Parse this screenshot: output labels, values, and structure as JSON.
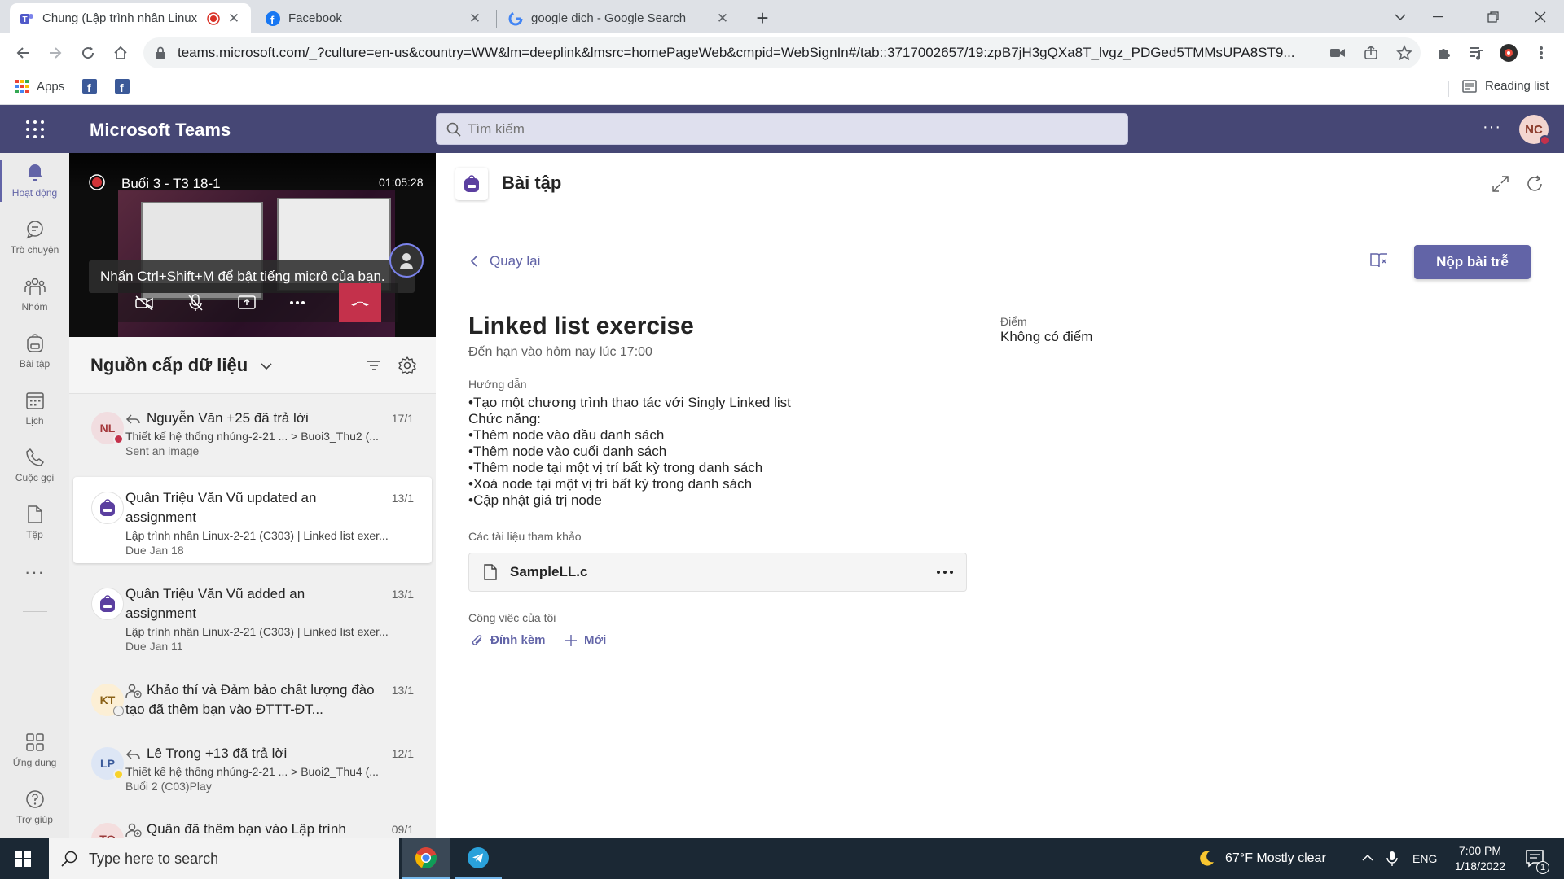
{
  "browser": {
    "tabs": [
      {
        "title": "Chung (Lập trình nhân Linux",
        "recording": true
      },
      {
        "title": "Facebook"
      },
      {
        "title": "google dich - Google Search"
      }
    ],
    "new_tab": "+",
    "url": "teams.microsoft.com/_?culture=en-us&country=WW&lm=deeplink&lmsrc=homePageWeb&cmpid=WebSignIn#/tab::3717002657/19:zpB7jH3gQXa8T_lvgz_PDGed5TMMsUPA8ST9...",
    "bookmarks": {
      "apps": "Apps",
      "reading_list": "Reading list"
    }
  },
  "teams": {
    "app_name": "Microsoft Teams",
    "search_placeholder": "Tìm kiếm",
    "avatar": "NC",
    "more": "···"
  },
  "rail": [
    {
      "label": "Hoạt động",
      "icon": "bell-icon",
      "active": true
    },
    {
      "label": "Trò chuyện",
      "icon": "chat-icon"
    },
    {
      "label": "Nhóm",
      "icon": "teams-icon"
    },
    {
      "label": "Bài tập",
      "icon": "backpack-icon"
    },
    {
      "label": "Lịch",
      "icon": "calendar-icon"
    },
    {
      "label": "Cuộc gọi",
      "icon": "phone-icon"
    },
    {
      "label": "Tệp",
      "icon": "file-icon"
    }
  ],
  "rail_more": "···",
  "rail_bottom": [
    {
      "label": "Ứng dụng",
      "icon": "apps-icon"
    },
    {
      "label": "Trợ giúp",
      "icon": "help-icon"
    }
  ],
  "meeting": {
    "title": "Buổi 3 - T3 18-1",
    "timer": "01:05:28",
    "toast": "Nhấn Ctrl+Shift+M để bật tiếng micrô của bạn."
  },
  "feed": {
    "title": "Nguồn cấp dữ liệu",
    "items": [
      {
        "avatar": "NL",
        "line1": "Nguyễn Văn +25 đã trả lời",
        "date": "17/1",
        "line2": "Thiết kế hệ thống nhúng-2-21 ...  > Buoi3_Thu2 (...",
        "line3": "Sent an image"
      },
      {
        "avatar": "",
        "line1": "Quân Triệu Văn Vũ updated an assignment",
        "date": "13/1",
        "line2": "Lập trình nhân Linux-2-21 (C303) | Linked list exer...",
        "line3": "Due Jan 18"
      },
      {
        "avatar": "",
        "line1": "Quân Triệu Văn Vũ added an assignment",
        "date": "13/1",
        "line2": "Lập trình nhân Linux-2-21 (C303) | Linked list exer...",
        "line3": "Due Jan 11"
      },
      {
        "avatar": "KT",
        "line1": "Khảo thí và Đảm bảo chất lượng đào tạo đã thêm bạn vào ĐTTT-ĐT...",
        "date": "13/1",
        "line2": "",
        "line3": ""
      },
      {
        "avatar": "LP",
        "line1": "Lê Trọng +13 đã trả lời",
        "date": "12/1",
        "line2": "Thiết kế hệ thống nhúng-2-21 ...  > Buoi2_Thu4 (...",
        "line3": "Buổi 2 (C03)Play"
      },
      {
        "avatar": "TQ",
        "line1": "Quân đã thêm bạn vào Lập trình",
        "date": "09/1",
        "line2": "",
        "line3": ""
      }
    ]
  },
  "assignment": {
    "page_title": "Bài tập",
    "back": "Quay lại",
    "submit": "Nộp bài trễ",
    "title": "Linked list exercise",
    "due": "Đến hạn vào hôm nay lúc 17:00",
    "points_label": "Điểm",
    "points_value": "Không có điểm",
    "instructions_label": "Hướng dẫn",
    "instructions": [
      "•Tạo một chương trình thao tác với Singly Linked list",
      "Chức năng:",
      "•Thêm node vào đầu danh sách",
      "•Thêm node vào cuối danh sách",
      "•Thêm node tại một vị trí bất kỳ trong danh sách",
      "•Xoá node tại một vị trí bất kỳ trong danh sách",
      "•Cập nhật giá trị node"
    ],
    "references_label": "Các tài liệu tham khảo",
    "file_name": "SampleLL.c",
    "my_work_label": "Công việc của tôi",
    "attach": "Đính kèm",
    "new": "Mới"
  },
  "taskbar": {
    "search_placeholder": "Type here to search",
    "weather": "67°F  Mostly clear",
    "lang": "ENG",
    "time": "7:00 PM",
    "date": "1/18/2022",
    "notif_count": "1"
  },
  "colors": {
    "teams_purple": "#6264a7",
    "teams_header": "#464775",
    "taskbar": "#1b2834"
  }
}
